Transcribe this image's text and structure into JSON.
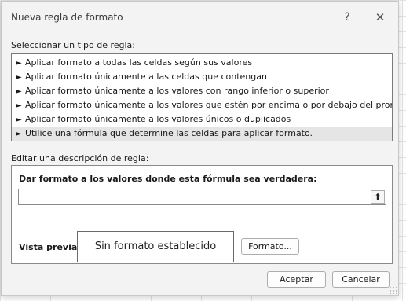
{
  "dialog": {
    "title": "Nueva regla de formato",
    "help_glyph": "?",
    "close_glyph": "✕"
  },
  "rule_type": {
    "label": "Seleccionar un tipo de regla:",
    "items": [
      {
        "label": "Aplicar formato a todas las celdas según sus valores"
      },
      {
        "label": "Aplicar formato únicamente a las celdas que contengan"
      },
      {
        "label": "Aplicar formato únicamente a los valores con rango inferior o superior"
      },
      {
        "label": "Aplicar formato únicamente a los valores que estén por encima o por debajo del promedio"
      },
      {
        "label": "Aplicar formato únicamente a los valores únicos o duplicados"
      },
      {
        "label": "Utilice una fórmula que determine las celdas para aplicar formato."
      }
    ],
    "selected_index": 5,
    "arrow_glyph": "►"
  },
  "description": {
    "label": "Editar una descripción de regla:",
    "formula_label": "Dar formato a los valores donde esta fórmula sea verdadera:",
    "formula_value": "",
    "collapse_glyph": "⬆",
    "preview_label": "Vista previa:",
    "preview_text": "Sin formato establecido",
    "format_button": "Formato..."
  },
  "footer": {
    "accept_button": "Aceptar",
    "cancel_button": "Cancelar"
  }
}
